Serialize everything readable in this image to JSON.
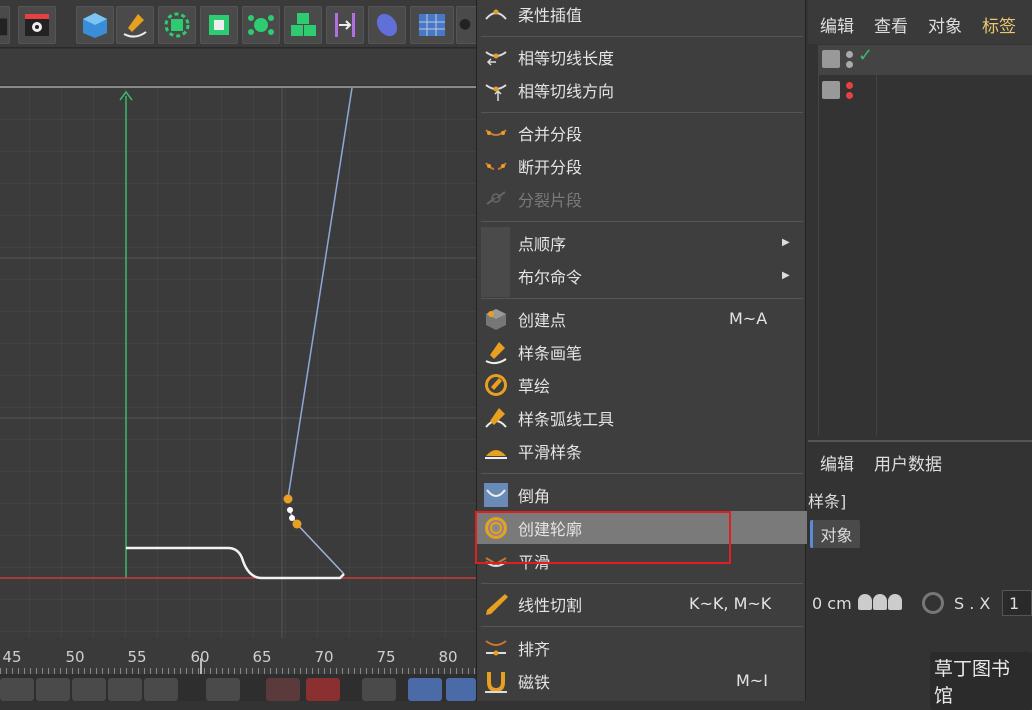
{
  "menu": {
    "items": [
      {
        "label": "柔性插值",
        "shortcut": "",
        "submenu": false,
        "enabled": true,
        "highlighted": false
      },
      {
        "label": "相等切线长度",
        "shortcut": "",
        "submenu": false,
        "enabled": true,
        "highlighted": false
      },
      {
        "label": "相等切线方向",
        "shortcut": "",
        "submenu": false,
        "enabled": true,
        "highlighted": false
      },
      {
        "label": "合并分段",
        "shortcut": "",
        "submenu": false,
        "enabled": true,
        "highlighted": false
      },
      {
        "label": "断开分段",
        "shortcut": "",
        "submenu": false,
        "enabled": true,
        "highlighted": false
      },
      {
        "label": "分裂片段",
        "shortcut": "",
        "submenu": false,
        "enabled": false,
        "highlighted": false
      },
      {
        "label": "点顺序",
        "shortcut": "",
        "submenu": true,
        "enabled": true,
        "highlighted": false
      },
      {
        "label": "布尔命令",
        "shortcut": "",
        "submenu": true,
        "enabled": true,
        "highlighted": false
      },
      {
        "label": "创建点",
        "shortcut": "M~A",
        "submenu": false,
        "enabled": true,
        "highlighted": false
      },
      {
        "label": "样条画笔",
        "shortcut": "",
        "submenu": false,
        "enabled": true,
        "highlighted": false
      },
      {
        "label": "草绘",
        "shortcut": "",
        "submenu": false,
        "enabled": true,
        "highlighted": false
      },
      {
        "label": "样条弧线工具",
        "shortcut": "",
        "submenu": false,
        "enabled": true,
        "highlighted": false
      },
      {
        "label": "平滑样条",
        "shortcut": "",
        "submenu": false,
        "enabled": true,
        "highlighted": false
      },
      {
        "label": "倒角",
        "shortcut": "",
        "submenu": false,
        "enabled": true,
        "highlighted": false
      },
      {
        "label": "创建轮廓",
        "shortcut": "",
        "submenu": false,
        "enabled": true,
        "highlighted": true
      },
      {
        "label": "平滑",
        "shortcut": "",
        "submenu": false,
        "enabled": true,
        "highlighted": false
      },
      {
        "label": "线性切割",
        "shortcut": "K~K, M~K",
        "submenu": false,
        "enabled": true,
        "highlighted": false
      },
      {
        "label": "排齐",
        "shortcut": "",
        "submenu": false,
        "enabled": true,
        "highlighted": false
      },
      {
        "label": "磁铁",
        "shortcut": "M~I",
        "submenu": false,
        "enabled": true,
        "highlighted": false
      }
    ]
  },
  "object_manager": {
    "menus": [
      "编辑",
      "查看",
      "对象",
      "标签"
    ]
  },
  "attribute_manager": {
    "menus": [
      "编辑",
      "用户数据"
    ],
    "object_type": "样条]",
    "tab": "对象",
    "position_value": "0 cm",
    "scale_label": "S . X",
    "scale_value": "1"
  },
  "timeline": {
    "ticks": [
      "45",
      "50",
      "55",
      "60",
      "65",
      "70",
      "75",
      "80"
    ]
  },
  "watermark": "草丁图书馆",
  "colors": {
    "accent_orange": "#e8a020",
    "highlight": "#7a7a7a",
    "annotation_red": "#e02020",
    "spline_blue": "#8fa8d8",
    "axis_green": "#3cba6e",
    "axis_red": "#c83c3c"
  }
}
